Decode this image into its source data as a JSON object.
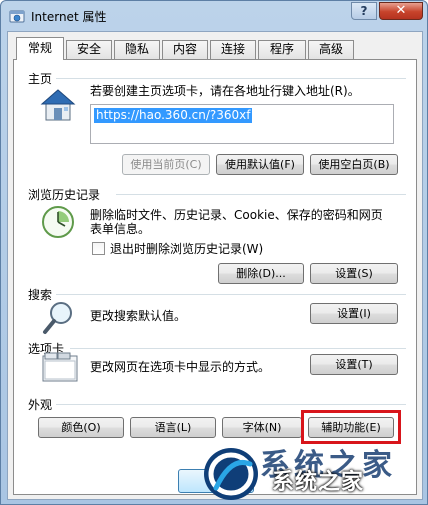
{
  "window": {
    "title": "Internet 属性",
    "help_label": "?",
    "close_label": "✕"
  },
  "tabs": [
    {
      "label": "常规"
    },
    {
      "label": "安全"
    },
    {
      "label": "隐私"
    },
    {
      "label": "内容"
    },
    {
      "label": "连接"
    },
    {
      "label": "程序"
    },
    {
      "label": "高级"
    }
  ],
  "home": {
    "title": "主页",
    "description": "若要创建主页选项卡，请在各地址行键入地址(R)。",
    "url": "https://hao.360.cn/?360xf",
    "use_current": "使用当前页(C)",
    "use_default": "使用默认值(F)",
    "use_blank": "使用空白页(B)"
  },
  "history": {
    "title": "浏览历史记录",
    "description_line1": "删除临时文件、历史记录、Cookie、保存的密码和网页",
    "description_line2": "表单信息。",
    "checkbox_label": "退出时删除浏览历史记录(W)",
    "delete_button": "删除(D)...",
    "settings_button": "设置(S)"
  },
  "search": {
    "title": "搜索",
    "description": "更改搜索默认值。",
    "settings_button": "设置(I)"
  },
  "tabs_section": {
    "title": "选项卡",
    "description": "更改网页在选项卡中显示的方式。",
    "settings_button": "设置(T)"
  },
  "appearance": {
    "title": "外观",
    "colors_button": "颜色(O)",
    "languages_button": "语言(L)",
    "fonts_button": "字体(N)",
    "accessibility_button": "辅助功能(E)"
  },
  "watermark": {
    "text": "系统之家",
    "back_text": "系统之家"
  },
  "colors": {
    "highlight": "#d8151b",
    "selection": "#3399ff"
  }
}
